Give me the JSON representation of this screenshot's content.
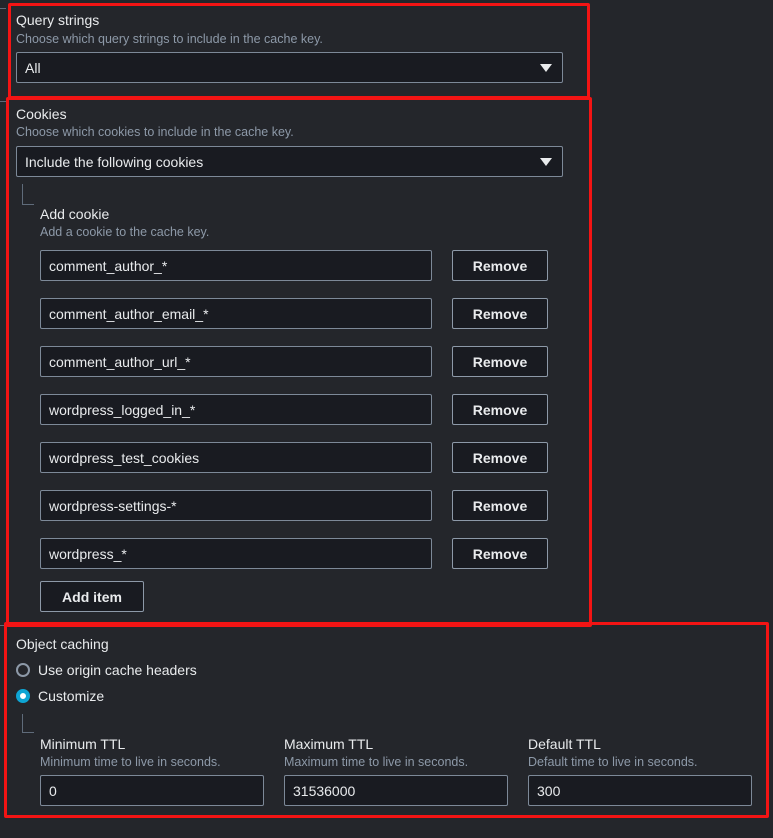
{
  "query_strings": {
    "title": "Query strings",
    "description": "Choose which query strings to include in the cache key.",
    "selected": "All"
  },
  "cookies": {
    "title": "Cookies",
    "description": "Choose which cookies to include in the cache key.",
    "selected": "Include the following cookies",
    "add_cookie_title": "Add cookie",
    "add_cookie_description": "Add a cookie to the cache key.",
    "items": [
      {
        "value": "comment_author_*",
        "remove_label": "Remove"
      },
      {
        "value": "comment_author_email_*",
        "remove_label": "Remove"
      },
      {
        "value": "comment_author_url_*",
        "remove_label": "Remove"
      },
      {
        "value": "wordpress_logged_in_*",
        "remove_label": "Remove"
      },
      {
        "value": "wordpress_test_cookies",
        "remove_label": "Remove"
      },
      {
        "value": "wordpress-settings-*",
        "remove_label": "Remove"
      },
      {
        "value": "wordpress_*",
        "remove_label": "Remove"
      }
    ],
    "add_item_label": "Add item"
  },
  "object_caching": {
    "title": "Object caching",
    "options": [
      {
        "label": "Use origin cache headers",
        "selected": false
      },
      {
        "label": "Customize",
        "selected": true
      }
    ],
    "min_ttl": {
      "label": "Minimum TTL",
      "description": "Minimum time to live in seconds.",
      "value": "0"
    },
    "max_ttl": {
      "label": "Maximum TTL",
      "description": "Maximum time to live in seconds.",
      "value": "31536000"
    },
    "default_ttl": {
      "label": "Default TTL",
      "description": "Default time to live in seconds.",
      "value": "300"
    }
  },
  "colors": {
    "highlight": "#f31414",
    "background": "#24262b",
    "input_bg": "#191b21",
    "radio_selected": "#0ea5d4"
  }
}
